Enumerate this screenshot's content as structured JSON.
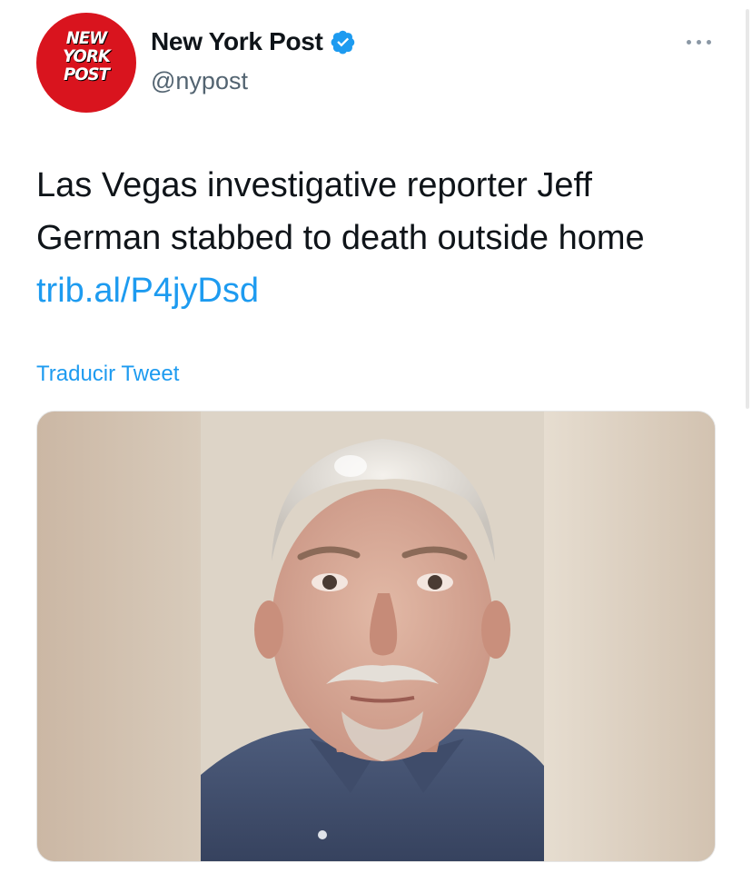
{
  "account": {
    "name": "New York Post",
    "handle": "@nypost",
    "logo_text": [
      "NEW",
      "YORK",
      "POST"
    ],
    "verified": true,
    "avatar_color": "#d9141e"
  },
  "tweet": {
    "text": "Las Vegas investigative reporter Jeff German stabbed to death outside home",
    "link": "trib.al/P4jyDsd",
    "translate_label": "Traducir Tweet"
  },
  "icons": {
    "verified": "verified-badge-icon",
    "more": "more-options-icon"
  },
  "colors": {
    "link": "#1d9bf0",
    "text": "#0f1419",
    "secondary": "#536471",
    "background": "#ffffff"
  }
}
